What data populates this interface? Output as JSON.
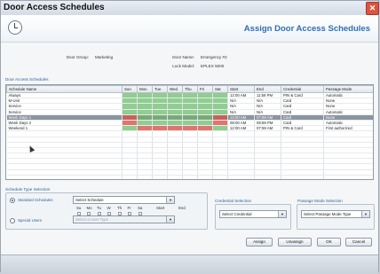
{
  "window": {
    "title": "Door Access Schedules"
  },
  "header": {
    "heading": "Assign Door Access Schedules"
  },
  "info": {
    "door_group_label": "Door Group:",
    "door_group_value": "Marketing",
    "door_name_label": "Door Name:",
    "door_name_value": "Emergency #2",
    "lock_model_label": "Lock Model:",
    "lock_model_value": "EPLEX 5000"
  },
  "schedules": {
    "section_title": "Door Access Schedules",
    "columns": [
      "Schedule Name",
      "Sun",
      "Mon",
      "Tue",
      "Wed",
      "Thu",
      "Fri",
      "Sat",
      "Start",
      "End",
      "Credential",
      "Passage Mode"
    ],
    "rows": [
      {
        "name": "Always",
        "days": [
          "g",
          "g",
          "g",
          "g",
          "g",
          "g",
          "g"
        ],
        "start": "12:00 AM",
        "end": "11:59 PM",
        "credential": "PIN & Card",
        "mode": "Automatic"
      },
      {
        "name": "M-Unit",
        "days": [
          "g",
          "g",
          "g",
          "g",
          "g",
          "g",
          "g"
        ],
        "start": "N/A",
        "end": "N/A",
        "credential": "Card",
        "mode": "None"
      },
      {
        "name": "Service",
        "days": [
          "g",
          "g",
          "g",
          "g",
          "g",
          "g",
          "g"
        ],
        "start": "N/A",
        "end": "N/A",
        "credential": "Card",
        "mode": "None"
      },
      {
        "name": "Service",
        "days": [
          "g",
          "g",
          "g",
          "g",
          "g",
          "g",
          "g"
        ],
        "start": "N/A",
        "end": "N/A",
        "credential": "Card",
        "mode": "Automatic"
      },
      {
        "name": "Week Days 1",
        "days": [
          "r",
          "g",
          "g",
          "g",
          "g",
          "g",
          "r"
        ],
        "start": "12:00 AM",
        "end": "07:59 AM",
        "credential": "Card",
        "mode": "None",
        "selected": true
      },
      {
        "name": "Week Days 2",
        "days": [
          "r",
          "g",
          "g",
          "g",
          "g",
          "g",
          "r"
        ],
        "start": "08:00 AM",
        "end": "09:59 PM",
        "credential": "Card",
        "mode": "Automatic"
      },
      {
        "name": "Weekend 1",
        "days": [
          "g",
          "r",
          "r",
          "r",
          "r",
          "r",
          "g"
        ],
        "start": "12:00 AM",
        "end": "07:59 AM",
        "credential": "PIN & Card",
        "mode": "First authorized"
      }
    ],
    "empty_rows": 11
  },
  "schedule_type": {
    "section_title": "Schedule Type Selection",
    "standard_label": "Standard Schedules",
    "standard_select": "Select Schedule",
    "day_labels": [
      "Su",
      "Mo",
      "Tu",
      "W",
      "Th",
      "Fr",
      "Sa"
    ],
    "start_label": "Start",
    "end_label": "End",
    "special_label": "Special Users",
    "special_select": "Select a User Type"
  },
  "credential": {
    "section_title": "Credential Selection",
    "select": "Select Credential"
  },
  "passage": {
    "section_title": "Passage Mode Selection",
    "select": "Select Passage Mode Type"
  },
  "buttons": {
    "assign": "Assign",
    "unassign": "Unassign",
    "ok": "OK",
    "cancel": "Cancel"
  },
  "icons": {
    "clock": "clock-icon",
    "close": "close-icon",
    "dropdown": "chevron-down-icon"
  },
  "colors": {
    "accent": "#2f6fb3",
    "allowed": "#8fce8f",
    "denied": "#e2746c",
    "selected_row": "#8b95a0"
  }
}
